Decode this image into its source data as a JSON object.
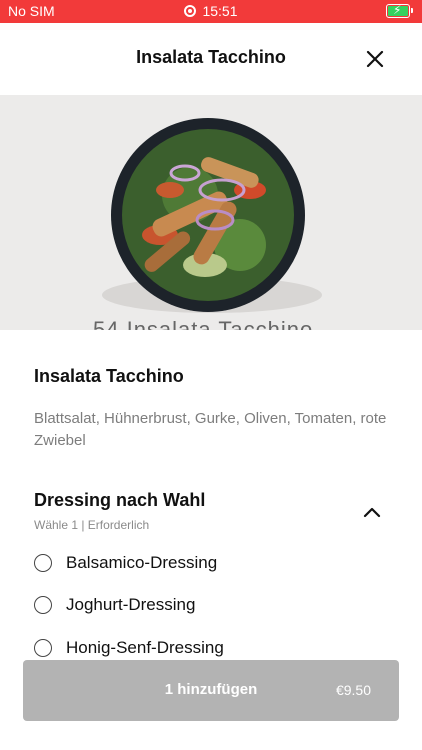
{
  "status_bar": {
    "carrier": "No SIM",
    "time": "15:51"
  },
  "header": {
    "title": "Insalata Tacchino",
    "close_icon": "close-icon"
  },
  "hero": {
    "caption_partial": "54 Insalata Tacchino"
  },
  "item": {
    "name": "Insalata Tacchino",
    "description": "Blattsalat, Hühnerbrust, Gurke, Oliven, Tomaten, rote Zwiebel"
  },
  "dressing": {
    "title": "Dressing nach Wahl",
    "subtitle": "Wähle 1  |  Erforderlich",
    "options": [
      "Balsamico-Dressing",
      "Joghurt-Dressing",
      "Honig-Senf-Dressing"
    ]
  },
  "cart": {
    "add_label": "1 hinzufügen",
    "price": "€9.50"
  },
  "colors": {
    "status_bar": "#f23a3a",
    "button": "#b3b3b3",
    "battery": "#36d15e"
  }
}
